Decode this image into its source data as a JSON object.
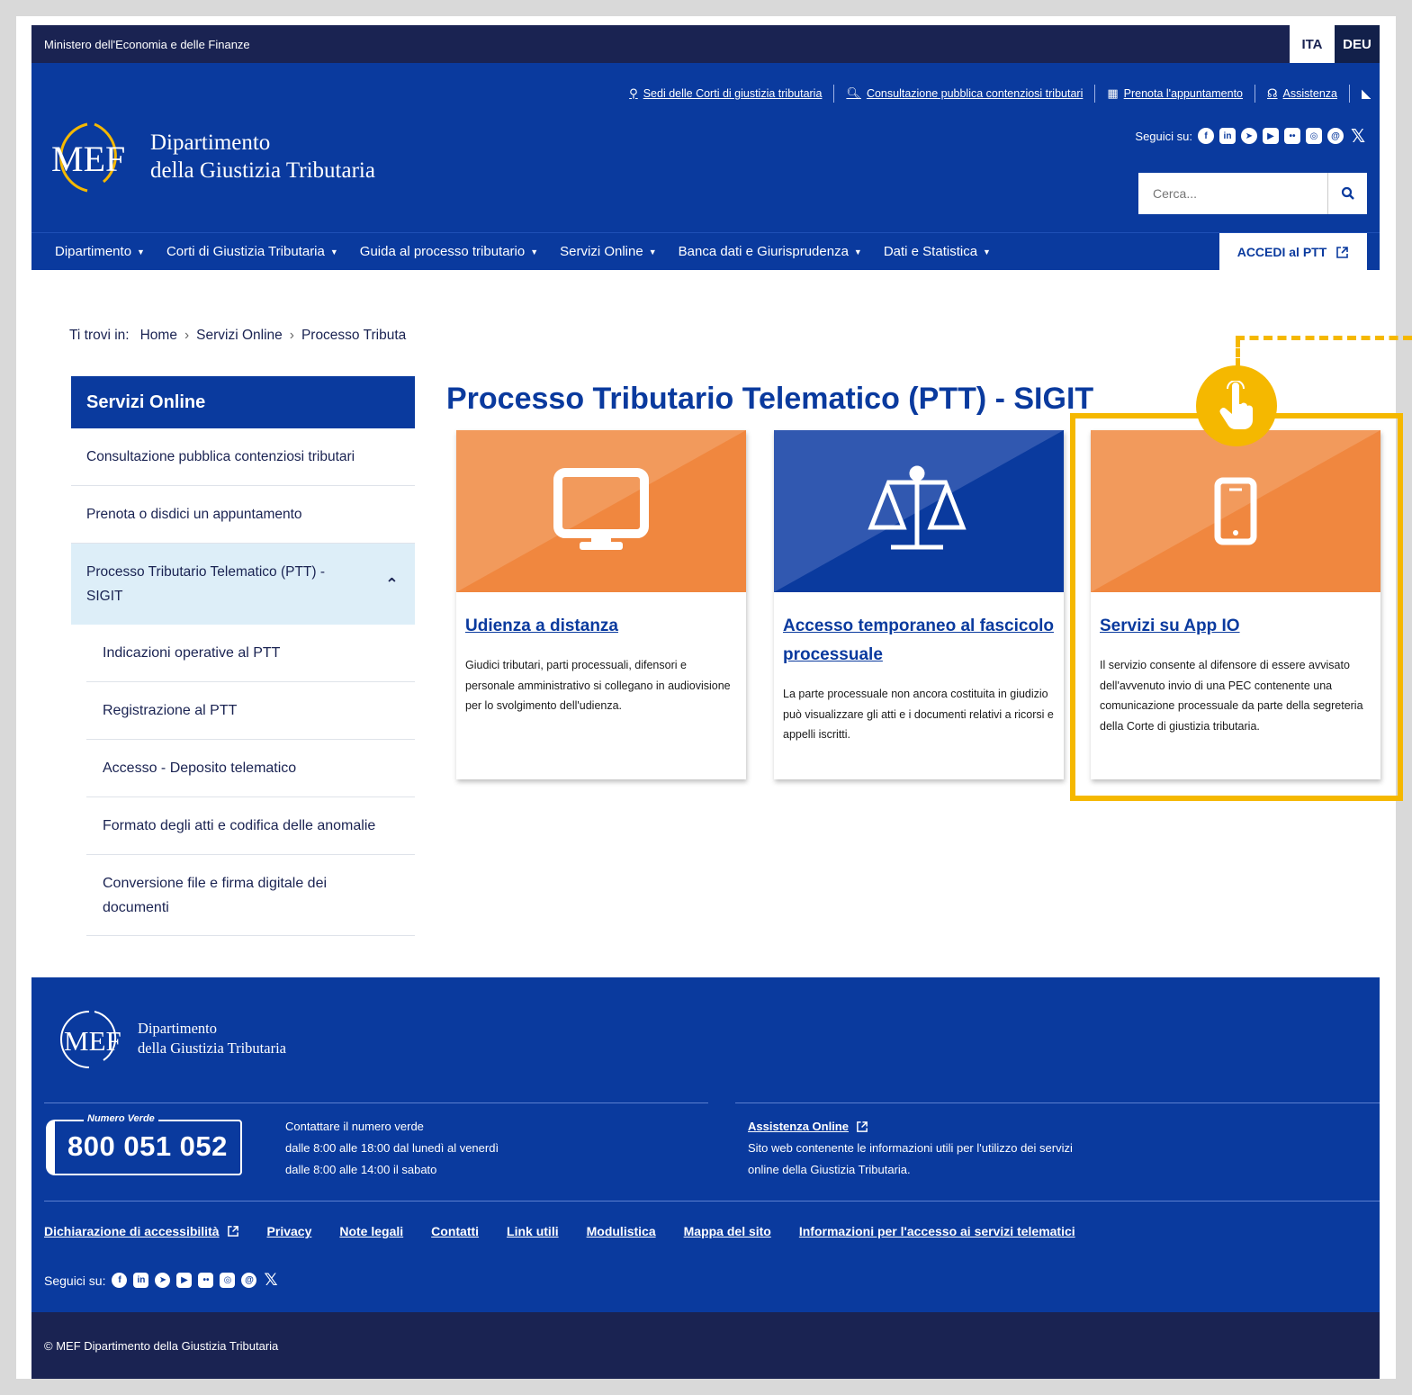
{
  "topbar": {
    "ministry": "Ministero dell'Economia e delle Finanze",
    "lang_active": "ITA",
    "lang_other": "DEU"
  },
  "utility_links": [
    {
      "icon": "map-marker-icon",
      "label": "Sedi delle Corti di giustizia tributaria"
    },
    {
      "icon": "search-doc-icon",
      "label": "Consultazione pubblica contenziosi tributari"
    },
    {
      "icon": "calendar-icon",
      "label": "Prenota l'appuntamento"
    },
    {
      "icon": "headset-icon",
      "label": "Assistenza"
    },
    {
      "icon": "rss-icon",
      "label": ""
    }
  ],
  "logo": {
    "mark": "MEF",
    "line1": "Dipartimento",
    "line2": "della Giustizia Tributaria"
  },
  "social": {
    "label": "Seguici su:",
    "icons": [
      "facebook-icon",
      "linkedin-icon",
      "telegram-icon",
      "youtube-icon",
      "flickr-icon",
      "instagram-icon",
      "threads-icon",
      "x-icon"
    ]
  },
  "search": {
    "placeholder": "Cerca..."
  },
  "nav": {
    "items": [
      "Dipartimento",
      "Corti di Giustizia Tributaria",
      "Guida al processo tributario",
      "Servizi Online",
      "Banca dati e Giurisprudenza",
      "Dati e Statistica"
    ],
    "accedi": "ACCEDI al PTT"
  },
  "breadcrumb": {
    "prefix": "Ti trovi in:",
    "home": "Home",
    "level1": "Servizi Online",
    "current": "Processo Tributa"
  },
  "sidebar": {
    "title": "Servizi Online",
    "items": [
      "Consultazione pubblica contenziosi tributari",
      "Prenota o disdici un appuntamento",
      "Processo Tributario Telematico (PTT) - SIGIT"
    ],
    "subitems": [
      "Indicazioni operative al PTT",
      "Registrazione al PTT",
      "Accesso - Deposito telematico",
      "Formato degli atti e codifica delle anomalie",
      "Conversione file e firma digitale dei documenti"
    ]
  },
  "main": {
    "title": "Processo Tributario Telematico (PTT) - SIGIT"
  },
  "cards": [
    {
      "icon": "monitor-icon",
      "title": "Udienza a distanza",
      "text": "Giudici tributari, parti processuali, difensori e personale amministrativo si collegano in audiovisione per lo svolgimento dell'udienza.",
      "color": "#f0873f"
    },
    {
      "icon": "scales-icon",
      "title": "Accesso temporaneo al fascicolo processuale",
      "text": "La parte processuale non ancora costituita in giudizio può visualizzare gli atti e i documenti relativi a ricorsi e appelli iscritti.",
      "color": "#0a3a9e"
    },
    {
      "icon": "smartphone-icon",
      "title": "Servizi su App IO",
      "text": "Il servizio consente al difensore di essere avvisato dell'avvenuto invio di una PEC contenente una comunicazione processuale da parte della segreteria della Corte di giustizia tributaria.",
      "color": "#f0873f"
    }
  ],
  "footer": {
    "logo_line1": "Dipartimento",
    "logo_line2": "della Giustizia Tributaria",
    "numero_verde_label": "Numero Verde",
    "numero_verde": "800 051 052",
    "contact_lines": [
      "Contattare il numero verde",
      "dalle 8:00 alle 18:00 dal lunedì al venerdì",
      "dalle 8:00 alle 14:00 il sabato"
    ],
    "assistenza_title": "Assistenza Online",
    "assistenza_lines": [
      "Sito web contenente le informazioni utili per l'utilizzo dei servizi",
      "online della Giustizia Tributaria."
    ],
    "links": [
      "Dichiarazione di accessibilità",
      "Privacy",
      "Note legali",
      "Contatti",
      "Link utili",
      "Modulistica",
      "Mappa del sito",
      "Informazioni per l'accesso ai servizi telematici"
    ],
    "social_label": "Seguici su:",
    "copyright": "© MEF Dipartimento della Giustizia Tributaria"
  },
  "colors": {
    "primary": "#0a3a9e",
    "dark": "#1a2352",
    "orange": "#f0873f",
    "highlight": "#f5b800"
  }
}
